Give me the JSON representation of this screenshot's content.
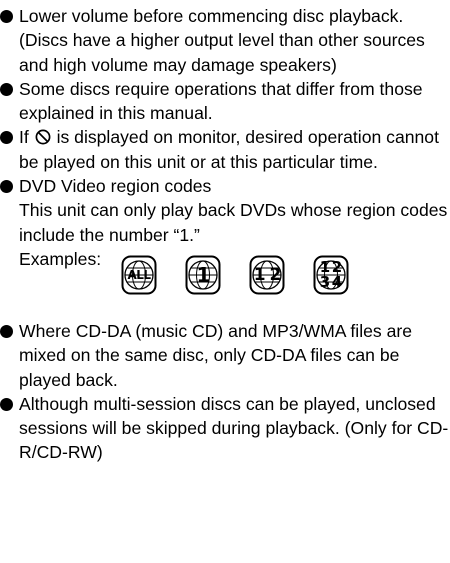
{
  "notes": [
    {
      "text": "Lower volume before commencing disc playback. (Discs have a higher output level than other sources and high volume may damage speakers)"
    },
    {
      "text": "Some discs require operations that differ from those explained in this manual."
    },
    {
      "text_before": "If",
      "icon": "prohibited-icon",
      "text_after": "is displayed on monitor, desired operation cannot be played on this unit or at this particular time."
    },
    {
      "title": "DVD Video region codes",
      "text": "This unit can only play back DVDs whose region codes include the number “1.”",
      "examples_label": "Examples:",
      "region_icons": [
        {
          "icon": "globe-region-icon",
          "label": "ALL"
        },
        {
          "icon": "globe-region-icon",
          "label": "1"
        },
        {
          "icon": "globe-region-icon",
          "label": "1 2"
        },
        {
          "icon": "globe-region-icon",
          "label_parts": [
            "1",
            "2",
            "3",
            "4"
          ]
        }
      ]
    },
    {
      "text": "Where CD-DA (music CD) and MP3/WMA files are mixed on the same disc, only CD-DA files can be played back."
    },
    {
      "text": "Although multi-session discs can be played, unclosed sessions will be skipped during playback. (Only for CD-R/CD-RW)"
    }
  ],
  "colors": {
    "text": "#000000",
    "background": "#ffffff"
  }
}
